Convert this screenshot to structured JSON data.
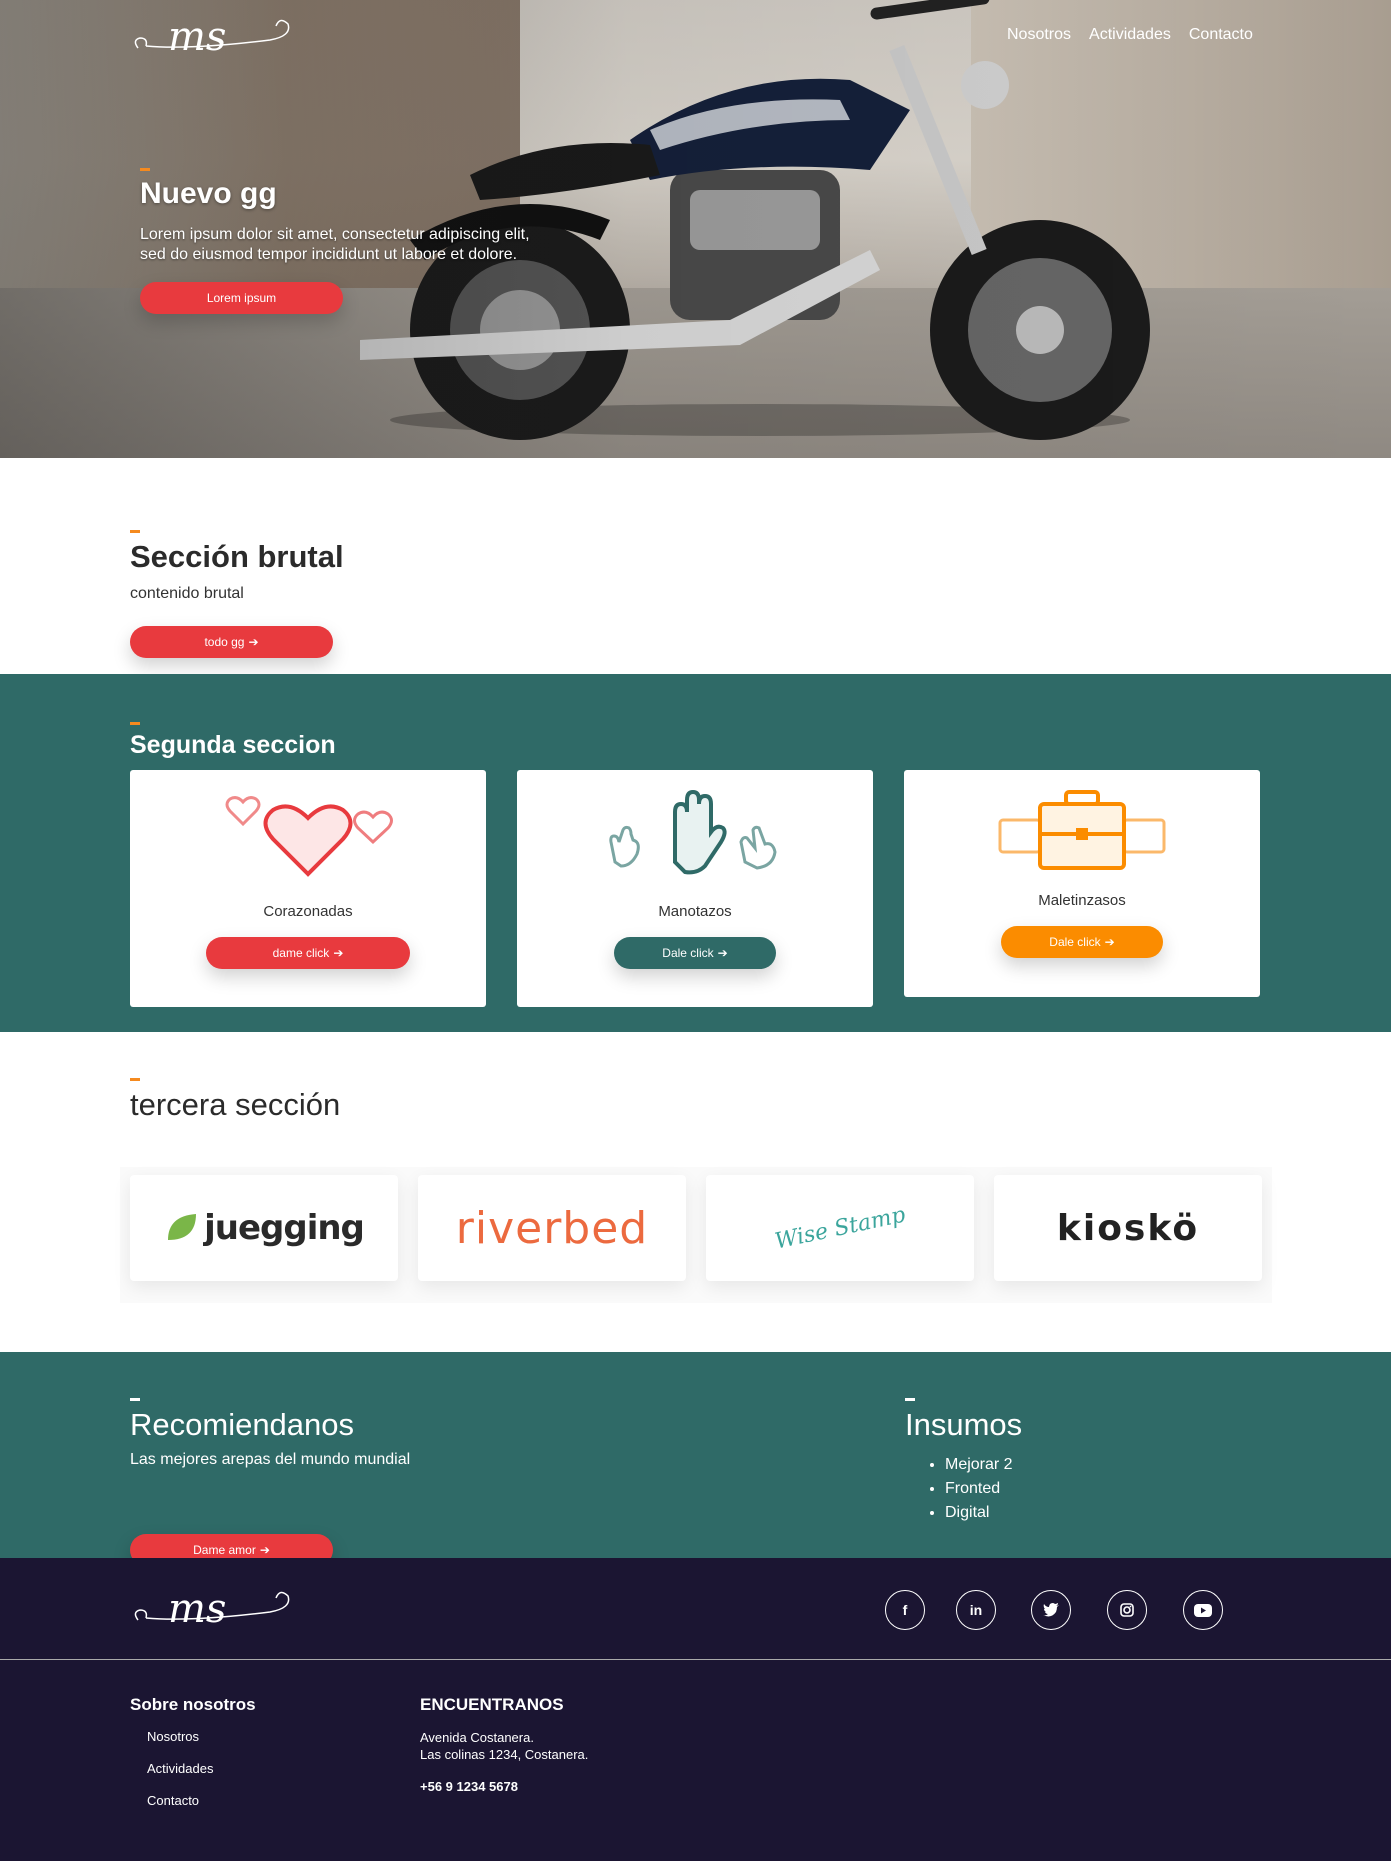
{
  "header": {
    "logo_text": "ms",
    "nav": [
      "Nosotros",
      "Actividades",
      "Contacto"
    ]
  },
  "hero": {
    "title": "Nuevo gg",
    "text_line1": "Lorem ipsum dolor sit amet, consectetur adipiscing elit,",
    "text_line2": "sed do eiusmod tempor incididunt ut labore et dolore.",
    "button": "Lorem ipsum"
  },
  "section1": {
    "title": "Sección brutal",
    "text": "contenido brutal",
    "button": "todo gg"
  },
  "section2": {
    "title": "Segunda seccion",
    "cards": [
      {
        "icon": "hearts-icon",
        "label": "Corazonadas",
        "button": "dame click",
        "button_color": "#e83a3e"
      },
      {
        "icon": "hands-icon",
        "label": "Manotazos",
        "button": "Dale click",
        "button_color": "#2f6a67"
      },
      {
        "icon": "briefcase-icon",
        "label": "Maletinzasos",
        "button": "Dale click",
        "button_color": "#fb8c00"
      }
    ]
  },
  "section3": {
    "title": "tercera sección",
    "logos": [
      "juegging",
      "riverbed",
      "Wise Stamp",
      "kioskö"
    ]
  },
  "section4": {
    "left_title": "Recomiendanos",
    "left_text": "Las mejores arepas del mundo mundial",
    "button": "Dame amor",
    "right_title": "Insumos",
    "items": [
      "Mejorar 2",
      "Fronted",
      "Digital"
    ]
  },
  "footer": {
    "logo_text": "ms",
    "social": [
      "facebook-icon",
      "linkedin-icon",
      "twitter-icon",
      "instagram-icon",
      "youtube-icon"
    ],
    "col1_title": "Sobre nosotros",
    "col1_links": [
      "Nosotros",
      "Actividades",
      "Contacto"
    ],
    "col2_title": "ENCUENTRANOS",
    "address_line1": "Avenida Costanera.",
    "address_line2": "Las colinas 1234, Costanera.",
    "phone": "+56 9 1234 5678"
  },
  "colors": {
    "accent_red": "#e83a3e",
    "teal": "#2f6a67",
    "orange": "#fb8c00",
    "footer_bg": "#1b1532",
    "accent_bar": "#f58a1f"
  }
}
